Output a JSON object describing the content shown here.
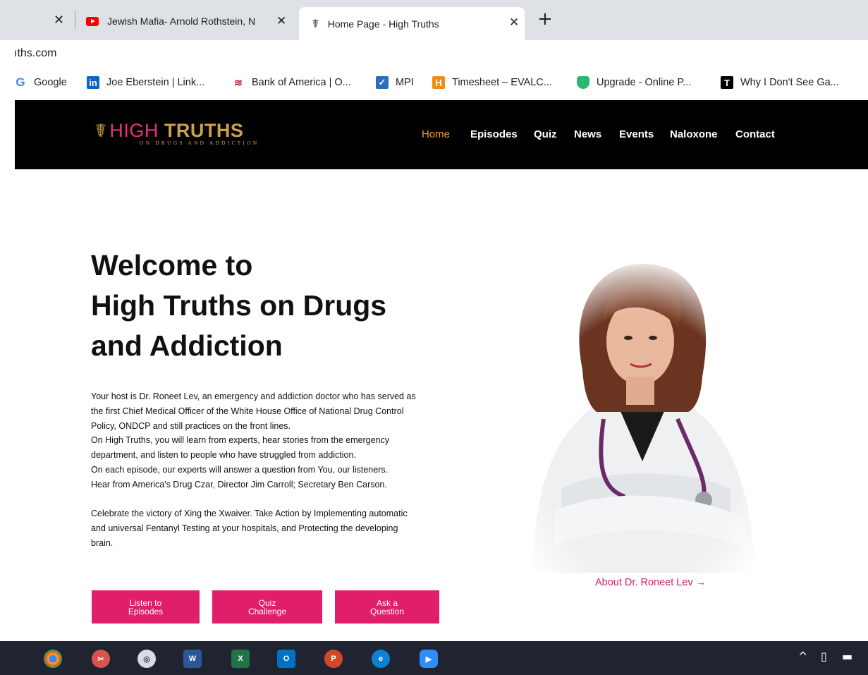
{
  "browser": {
    "tabs": [
      {
        "title": "Jewish Mafia- Arnold Rothstein, N",
        "icon": "youtube-icon"
      },
      {
        "title": "Home Page - High Truths",
        "icon": "caduceus-icon",
        "active": true
      }
    ],
    "new_tab_symbol": "+",
    "close_symbol": "✕",
    "url": "ıths.com",
    "bookmarks": [
      {
        "label": "Google",
        "icon": "google-icon"
      },
      {
        "label": "Joe Eberstein | Link...",
        "icon": "linkedin-icon"
      },
      {
        "label": "Bank of America | O...",
        "icon": "bank-of-america-icon"
      },
      {
        "label": "MPI",
        "icon": "mpi-icon"
      },
      {
        "label": "Timesheet – EVALC...",
        "icon": "timesheet-icon"
      },
      {
        "label": "Upgrade - Online P...",
        "icon": "upgrade-icon"
      },
      {
        "label": "Why I Don't See Ga...",
        "icon": "t-icon"
      }
    ]
  },
  "site": {
    "logo": {
      "high": "HIGH",
      "truths": "TRUTHS",
      "tagline": "ON DRUGS AND ADDICTION"
    },
    "nav": [
      "Home",
      "Episodes",
      "Quiz",
      "News",
      "Events",
      "Naloxone",
      "Contact"
    ],
    "hero": {
      "title_lines": [
        "Welcome to",
        "High Truths on Drugs",
        "and Addiction"
      ],
      "body_lines": [
        "Your host is Dr. Roneet Lev, an emergency and addiction doctor who has served as",
        "the first Chief Medical Officer of  the White House Office of National Drug Control",
        "Policy, ONDCP and still practices on the front lines.",
        "On High Truths, you will learn from experts, hear stories from the emergency",
        "department, and listen to people who have struggled from addiction.",
        "On each episode, our experts will answer a question from You, our listeners.",
        "Hear from America's Drug Czar, Director Jim Carroll; Secretary Ben Carson."
      ],
      "body_lines_2": [
        "Celebrate the victory of Xing the Xwaiver. Take Action by Implementing automatic",
        "and universal Fentanyl Testing at your hospitals, and Protecting the developing",
        "brain."
      ],
      "buttons": [
        "Listen to Episodes",
        "Quiz Challenge",
        "Ask a Question"
      ],
      "about_link": "About Dr. Roneet Lev →"
    },
    "colors": {
      "accent": "#e01e6a",
      "gold": "#c9a24a",
      "nav_active": "#e8a030"
    }
  },
  "taskbar": {
    "apps": [
      "chrome-icon",
      "snip-icon",
      "seal-icon",
      "word-icon",
      "excel-icon",
      "outlook-icon",
      "powerpoint-icon",
      "edge-icon",
      "zoom-icon"
    ],
    "tray": [
      "chevron-up-icon",
      "usb-icon",
      "battery-icon"
    ]
  }
}
